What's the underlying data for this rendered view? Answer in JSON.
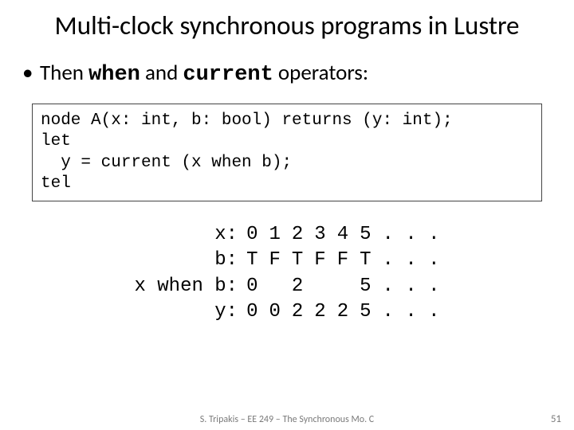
{
  "title": "Multi-clock synchronous programs in Lustre",
  "bullet": {
    "pre": "Then ",
    "kw1": "when",
    "mid": " and ",
    "kw2": "current",
    "post": " operators:"
  },
  "code": "node A(x: int, b: bool) returns (y: int);\nlet\n  y = current (x when b);\ntel",
  "trace": {
    "rows": [
      {
        "label": "x:",
        "cells": [
          "0",
          "1",
          "2",
          "3",
          "4",
          "5",
          ". . ."
        ]
      },
      {
        "label": "b:",
        "cells": [
          "T",
          "F",
          "T",
          "F",
          "F",
          "T",
          ". . ."
        ]
      },
      {
        "label": "x when b:",
        "cells": [
          "0",
          "",
          "2",
          "",
          "",
          "5",
          ". . ."
        ]
      },
      {
        "label": "y:",
        "cells": [
          "0",
          "0",
          "2",
          "2",
          "2",
          "5",
          ". . ."
        ]
      }
    ]
  },
  "footer": "S. Tripakis – EE 249 – The Synchronous Mo. C",
  "page": "51"
}
